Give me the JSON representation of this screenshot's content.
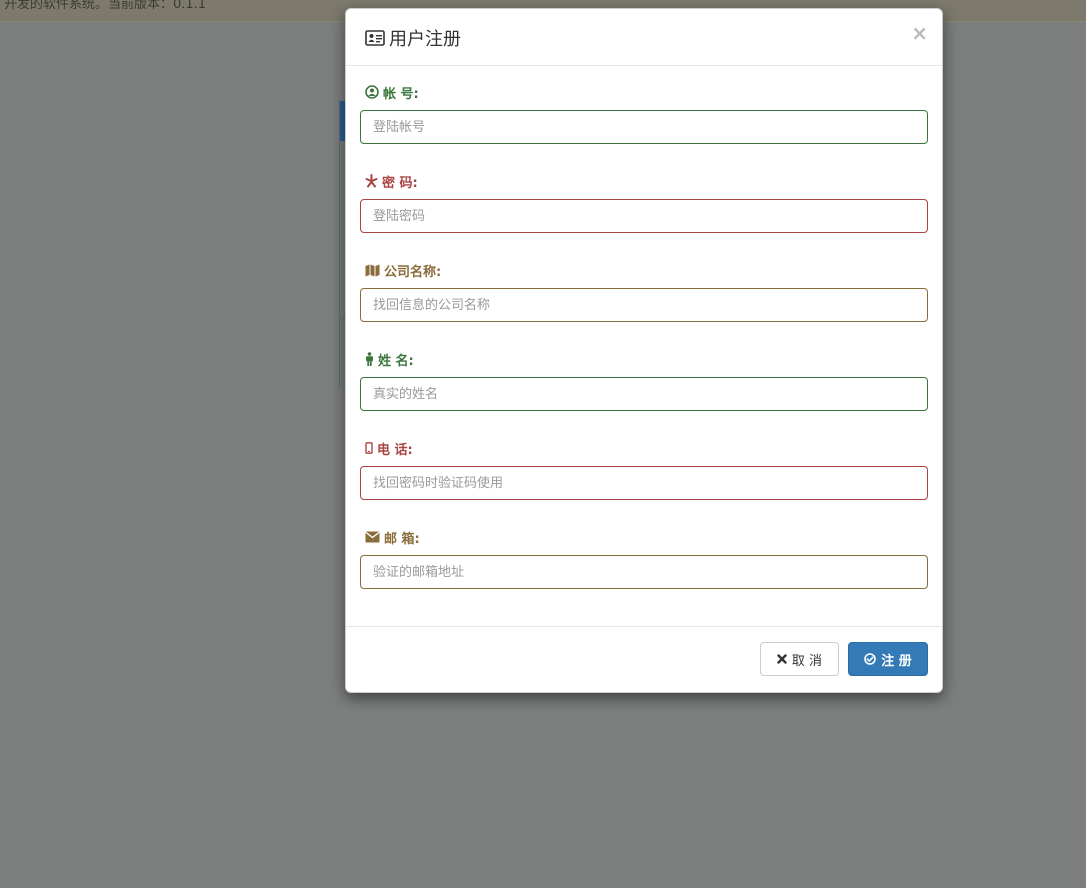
{
  "background": {
    "banner_text": "开发的软件系统。当前版本：0.1.1"
  },
  "modal": {
    "title": "用户注册",
    "close_label": "×",
    "fields": [
      {
        "label": "帐 号:",
        "placeholder": "登陆帐号",
        "color": "#3c763d",
        "icon": "user-circle-icon"
      },
      {
        "label": "密 码:",
        "placeholder": "登陆密码",
        "color": "#a94442",
        "icon": "asterisk-icon"
      },
      {
        "label": "公司名称:",
        "placeholder": "找回信息的公司名称",
        "color": "#8a6d3b",
        "icon": "map-icon"
      },
      {
        "label": "姓 名:",
        "placeholder": "真实的姓名",
        "color": "#3c763d",
        "icon": "person-icon"
      },
      {
        "label": "电 话:",
        "placeholder": "找回密码时验证码使用",
        "color": "#a94442",
        "icon": "mobile-icon"
      },
      {
        "label": "邮 箱:",
        "placeholder": "验证的邮箱地址",
        "color": "#8a6d3b",
        "icon": "envelope-icon"
      }
    ],
    "footer": {
      "cancel_label": "取 消",
      "submit_label": "注 册"
    }
  },
  "colors": {
    "primary": "#337ab7",
    "success": "#3c763d",
    "danger": "#a94442",
    "warning": "#8a6d3b"
  }
}
